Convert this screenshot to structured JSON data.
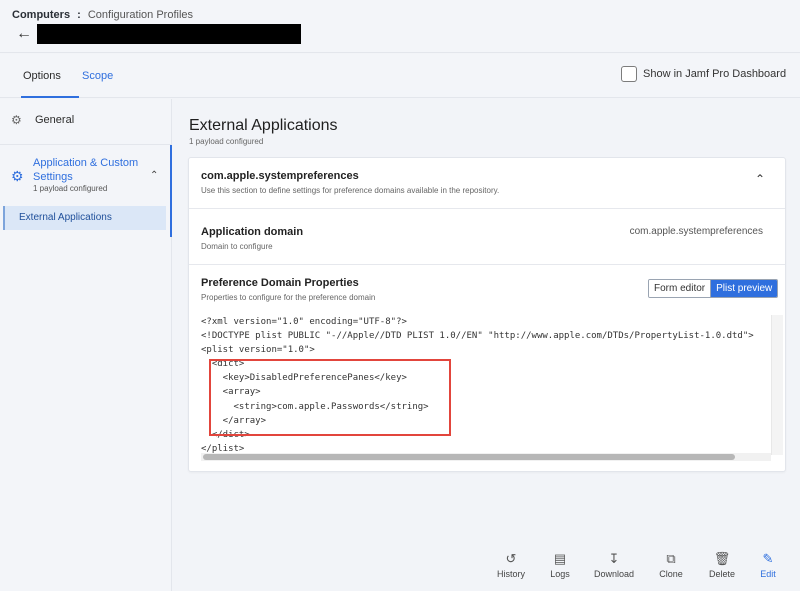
{
  "header": {
    "breadcrumb": [
      "Computers",
      "Configuration Profiles"
    ],
    "breadcrumb_sep": ":",
    "back_icon": "arrow-left-icon"
  },
  "tabs": {
    "options": "Options",
    "scope": "Scope",
    "show_in_dashboard": "Show in Jamf Pro Dashboard"
  },
  "sidebar": {
    "general": "General",
    "app_custom": "Application & Custom Settings",
    "app_custom_sub": "1 payload configured",
    "external_apps": "External Applications"
  },
  "main": {
    "title": "External Applications",
    "subtitle": "1 payload configured",
    "domain_header": "com.apple.systempreferences",
    "domain_header_desc": "Use this section to define settings for preference domains available in the repository.",
    "app_domain_label": "Application domain",
    "app_domain_desc": "Domain to configure",
    "app_domain_value": "com.apple.systempreferences",
    "pref_label": "Preference Domain Properties",
    "pref_desc": "Properties to configure for the preference domain",
    "form_editor": "Form editor",
    "plist_preview": "Plist preview",
    "code": "<?xml version=\"1.0\" encoding=\"UTF-8\"?>\n<!DOCTYPE plist PUBLIC \"-//Apple//DTD PLIST 1.0//EN\" \"http://www.apple.com/DTDs/PropertyList-1.0.dtd\">\n<plist version=\"1.0\">\n  <dict>\n    <key>DisabledPreferencePanes</key>\n    <array>\n      <string>com.apple.Passwords</string>\n    </array>\n  </dict>\n</plist>"
  },
  "toolbar": {
    "history": "History",
    "logs": "Logs",
    "download": "Download",
    "clone": "Clone",
    "delete": "Delete",
    "edit": "Edit"
  },
  "colors": {
    "accent": "#2f6fde",
    "highlight_box": "#e2453c"
  }
}
